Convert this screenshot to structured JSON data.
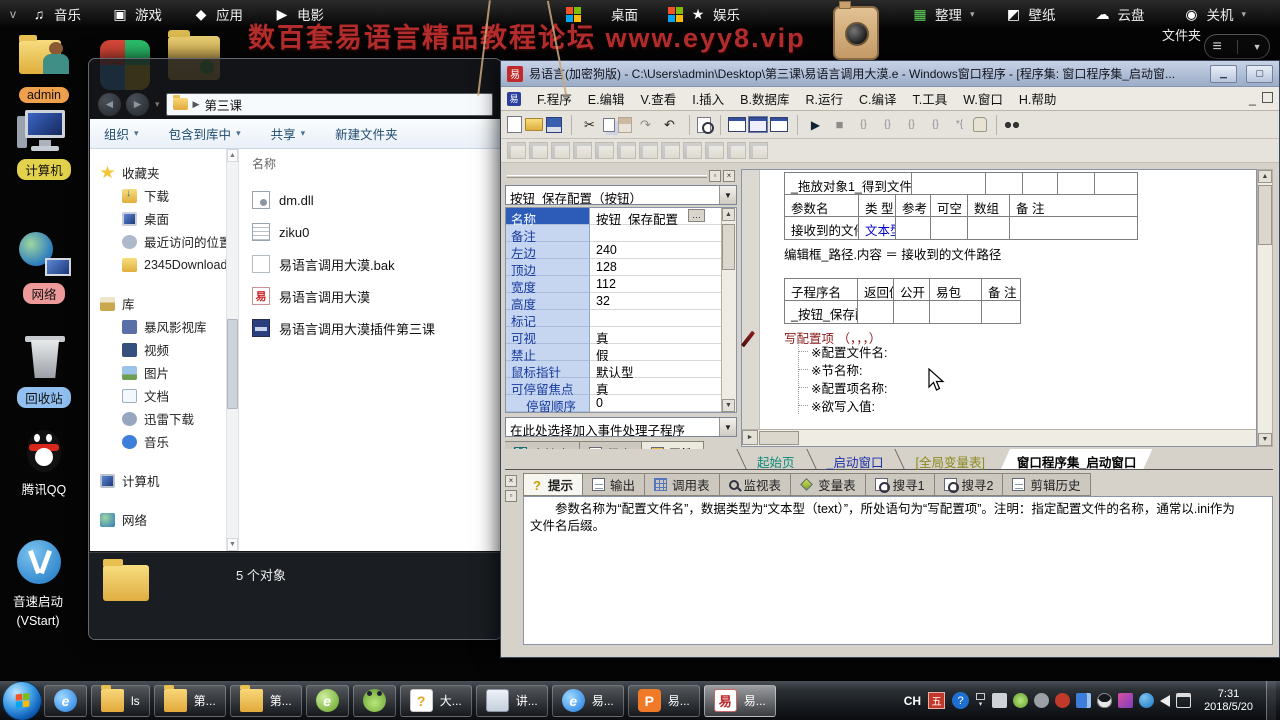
{
  "topbar": {
    "chevron": "v",
    "left": [
      {
        "label": "音乐",
        "icon": "music-icon",
        "g": "♫"
      },
      {
        "label": "游戏",
        "icon": "game-icon",
        "g": "▣"
      },
      {
        "label": "应用",
        "icon": "apps-icon",
        "g": "◆"
      },
      {
        "label": "电影",
        "icon": "movie-icon",
        "g": "▶"
      }
    ],
    "mid": [
      {
        "label": "桌面",
        "icon": "windows-desktop-icon",
        "g": ""
      },
      {
        "label": "娱乐",
        "icon": "entertainment-star-icon",
        "g": "★"
      }
    ],
    "right": [
      {
        "label": "整理",
        "icon": "organize-icon",
        "g": "▦",
        "dd": "▾",
        "green": "green"
      },
      {
        "label": "壁纸",
        "icon": "wallpaper-icon",
        "g": "◩",
        "dd": ""
      },
      {
        "label": "云盘",
        "icon": "cloud-icon",
        "g": "☁",
        "dd": ""
      },
      {
        "label": "关机",
        "icon": "power-icon",
        "g": "◉",
        "dd": "▾"
      }
    ]
  },
  "watermark": {
    "text": "数百套易语言精品教程论坛 www.eyy8.vip",
    "color": "#b22c2c"
  },
  "organizer": {
    "folder_label": "文件夹"
  },
  "desktop": {
    "icons": [
      {
        "label": "admin",
        "bubble": "#efa04d"
      },
      {
        "label": "计算机",
        "bubble": "#e3d24b"
      },
      {
        "label": "网络",
        "bubble": "#ef9a9a"
      },
      {
        "label": "回收站",
        "bubble": "#90bff0"
      },
      {
        "label": "腾讯QQ",
        "bubble": ""
      },
      {
        "label": "音速启动",
        "label2": "(VStart)",
        "bubble": ""
      }
    ]
  },
  "explorer": {
    "address": "第三课",
    "toolbar": [
      {
        "label": "组织",
        "dd": "▾"
      },
      {
        "label": "包含到库中",
        "dd": "▾"
      },
      {
        "label": "共享",
        "dd": "▾"
      },
      {
        "label": "新建文件夹",
        "dd": ""
      }
    ],
    "sidebar": [
      {
        "label": "收藏夹",
        "icon": "favorites-star-icon",
        "cls": "lv0",
        "ic": "s-star"
      },
      {
        "label": "下载",
        "icon": "downloads-icon",
        "cls": "lv1",
        "ic": "s-down"
      },
      {
        "label": "桌面",
        "icon": "desktop-location-icon",
        "cls": "lv1",
        "ic": "s-mon"
      },
      {
        "label": "最近访问的位置",
        "icon": "recent-places-icon",
        "cls": "lv1",
        "ic": "s-recent"
      },
      {
        "label": "2345Downloads",
        "icon": "folder-icon",
        "cls": "lv1",
        "ic": "s-folder"
      },
      {
        "label": "库",
        "icon": "libraries-icon",
        "cls": "lv0 gap",
        "ic": "s-lib"
      },
      {
        "label": "暴风影视库",
        "icon": "movie-library-icon",
        "cls": "lv1",
        "ic": "s-movie"
      },
      {
        "label": "视频",
        "icon": "videos-icon",
        "cls": "lv1",
        "ic": "s-video"
      },
      {
        "label": "图片",
        "icon": "pictures-icon",
        "cls": "lv1",
        "ic": "s-pic"
      },
      {
        "label": "文档",
        "icon": "documents-icon",
        "cls": "lv1",
        "ic": "s-doc"
      },
      {
        "label": "迅雷下载",
        "icon": "thunder-download-icon",
        "cls": "lv1",
        "ic": "s-thunder"
      },
      {
        "label": "音乐",
        "icon": "music-library-icon",
        "cls": "lv1",
        "ic": "s-music"
      },
      {
        "label": "计算机",
        "icon": "computer-icon",
        "cls": "lv0 gap",
        "ic": "s-computer"
      },
      {
        "label": "网络",
        "icon": "network-icon",
        "cls": "lv0 gap",
        "ic": "s-network"
      }
    ],
    "files_header": "名称",
    "files": [
      {
        "name": "dm.dll",
        "icon": "dll-file-icon",
        "ic": "f-dll",
        "g": ""
      },
      {
        "name": "ziku0",
        "icon": "text-file-icon",
        "ic": "f-txt",
        "g": ""
      },
      {
        "name": "易语言调用大漠.bak",
        "icon": "bak-file-icon",
        "ic": "f-bak",
        "g": ""
      },
      {
        "name": "易语言调用大漠",
        "icon": "elang-source-file-icon",
        "ic": "f-eyy",
        "g": "易"
      },
      {
        "name": "易语言调用大漠插件第三课",
        "icon": "media-file-icon",
        "ic": "f-media",
        "g": ""
      }
    ],
    "status": "5 个对象"
  },
  "ide": {
    "title": "易语言(加密狗版) - C:\\Users\\admin\\Desktop\\第三课\\易语言调用大漠.e - Windows窗口程序 - [程序集: 窗口程序集_启动窗...",
    "logo": "易",
    "menus": [
      {
        "label": "F.程序"
      },
      {
        "label": "E.编辑"
      },
      {
        "label": "V.查看"
      },
      {
        "label": "I.插入"
      },
      {
        "label": "B.数据库"
      },
      {
        "label": "R.运行"
      },
      {
        "label": "C.编译"
      },
      {
        "label": "T.工具"
      },
      {
        "label": "W.窗口"
      },
      {
        "label": "H.帮助"
      }
    ],
    "child_min": "_",
    "toolbar1": [
      {
        "name": "new-icon",
        "cls": "ti-doc",
        "g": ""
      },
      {
        "name": "open-icon",
        "cls": "ti-open",
        "g": ""
      },
      {
        "name": "save-icon",
        "cls": "ti-save",
        "g": ""
      },
      {
        "name": "separator",
        "cls": "ti-sep",
        "g": ""
      },
      {
        "name": "cut-icon",
        "cls": "",
        "g": "✂"
      },
      {
        "name": "copy-icon",
        "cls": "ti-copy",
        "g": ""
      },
      {
        "name": "paste-icon",
        "cls": "ti-paste dim",
        "g": ""
      },
      {
        "name": "redo-icon",
        "cls": "dim",
        "g": "↷"
      },
      {
        "name": "undo-icon",
        "cls": "",
        "g": "↶"
      },
      {
        "name": "separator",
        "cls": "ti-sep",
        "g": ""
      },
      {
        "name": "find-icon",
        "cls": "ti-find",
        "g": ""
      },
      {
        "name": "separator",
        "cls": "ti-sep",
        "g": ""
      },
      {
        "name": "window-layout-left-icon",
        "cls": "ti-win",
        "g": ""
      },
      {
        "name": "window-layout-bottom-icon",
        "cls": "ti-win on",
        "g": ""
      },
      {
        "name": "window-layout-grid-icon",
        "cls": "ti-win",
        "g": ""
      },
      {
        "name": "separator",
        "cls": "ti-sep",
        "g": ""
      },
      {
        "name": "run-icon",
        "cls": "run",
        "g": "▶"
      },
      {
        "name": "stop-icon",
        "cls": "dim",
        "g": "■"
      },
      {
        "name": "debug-breakpoint-icon",
        "cls": "dim2",
        "g": "{}"
      },
      {
        "name": "step-over-icon",
        "cls": "dim2",
        "g": "{}"
      },
      {
        "name": "step-into-icon",
        "cls": "dim2",
        "g": "{}"
      },
      {
        "name": "step-out-icon",
        "cls": "dim2",
        "g": "{}"
      },
      {
        "name": "run-to-cursor-icon",
        "cls": "dim2",
        "g": "*{"
      },
      {
        "name": "hand-icon",
        "cls": "ti-hand",
        "g": ""
      },
      {
        "name": "separator",
        "cls": "ti-sep",
        "g": ""
      },
      {
        "name": "find-in-files-icon",
        "cls": "ti-bino",
        "g": ""
      }
    ],
    "toolbar2": [
      {
        "name": "snap-grid-icon"
      },
      {
        "name": "align-left-icon"
      },
      {
        "name": "align-right-icon"
      },
      {
        "name": "align-top-icon"
      },
      {
        "name": "align-bottom-icon"
      },
      {
        "name": "center-horizontal-icon"
      },
      {
        "name": "center-vertical-icon"
      },
      {
        "name": "space-horizontal-icon"
      },
      {
        "name": "space-vertical-icon"
      },
      {
        "name": "same-width-icon"
      },
      {
        "name": "same-height-icon"
      },
      {
        "name": "same-size-icon"
      }
    ],
    "properties": {
      "selector": "按钮_保存配置（按钮）",
      "rows": [
        {
          "label": "名称",
          "value": "按钮_保存配置",
          "cls": "sel",
          "more": "…"
        },
        {
          "label": "备注",
          "value": "",
          "cls": "",
          "more": ""
        },
        {
          "label": "左边",
          "value": "240",
          "cls": "",
          "more": ""
        },
        {
          "label": "顶边",
          "value": "128",
          "cls": "",
          "more": ""
        },
        {
          "label": "宽度",
          "value": "112",
          "cls": "",
          "more": ""
        },
        {
          "label": "高度",
          "value": "32",
          "cls": "",
          "more": ""
        },
        {
          "label": "标记",
          "value": "",
          "cls": "",
          "more": ""
        },
        {
          "label": "可视",
          "value": "真",
          "cls": "",
          "more": ""
        },
        {
          "label": "禁止",
          "value": "假",
          "cls": "",
          "more": ""
        },
        {
          "label": "鼠标指针",
          "value": "默认型",
          "cls": "",
          "more": ""
        },
        {
          "label": "可停留焦点",
          "value": "真",
          "cls": "",
          "more": ""
        },
        {
          "label": "停留顺序",
          "value": "0",
          "cls": "ind",
          "more": ""
        }
      ],
      "event_selector": "在此处选择加入事件处理子程序",
      "tabs": [
        {
          "label": "支持库",
          "icon": "support-library-tab-icon",
          "cls": "",
          "ic": "mi-lib"
        },
        {
          "label": "程序",
          "icon": "program-tab-icon",
          "cls": "",
          "ic": "mi-prog"
        },
        {
          "label": "属性",
          "icon": "property-tab-icon",
          "cls": "on",
          "ic": "mi-prop"
        }
      ]
    },
    "code": {
      "t1_title": "_拖放对象1_得到文件",
      "t1_headers": [
        {
          "t": "参数名"
        },
        {
          "t": "类 型"
        },
        {
          "t": "参考"
        },
        {
          "t": "可空"
        },
        {
          "t": "数组"
        },
        {
          "t": "备 注"
        }
      ],
      "t1_row": [
        {
          "t": "接收到的文件路径",
          "cls": ""
        },
        {
          "t": "文本型",
          "cls": "blue"
        },
        {
          "t": ""
        },
        {
          "t": ""
        },
        {
          "t": ""
        },
        {
          "t": ""
        }
      ],
      "statement": "编辑框_路径.内容 ＝ 接收到的文件路径",
      "t2_headers": [
        {
          "t": "子程序名"
        },
        {
          "t": "返回值类型"
        },
        {
          "t": "公开"
        },
        {
          "t": "易包"
        },
        {
          "t": "备 注"
        }
      ],
      "t2_row": [
        {
          "t": "_按钮_保存配置_被单击"
        },
        {
          "t": ""
        },
        {
          "t": ""
        },
        {
          "t": ""
        },
        {
          "t": ""
        }
      ],
      "call": "写配置项 （，，，）",
      "params": [
        {
          "t": "※配置文件名:"
        },
        {
          "t": "※节名称:"
        },
        {
          "t": "※配置项名称:"
        },
        {
          "t": "※欲写入值:"
        }
      ]
    },
    "doc_tabs": [
      {
        "label": "起始页",
        "color": "#0d8a7a",
        "cls": ""
      },
      {
        "label": "_启动窗口",
        "color": "#1b2fa8",
        "cls": ""
      },
      {
        "label": "[全局变量表]",
        "color": "#8a8a1e",
        "cls": ""
      },
      {
        "label": "窗口程序集_启动窗口",
        "color": "#000000",
        "cls": "on"
      }
    ],
    "bottom_tabs": [
      {
        "label": "提示",
        "icon": "hint-tab-icon",
        "cls": "on",
        "ic": "mi-q",
        "g": "?"
      },
      {
        "label": "输出",
        "icon": "output-tab-icon",
        "cls": "",
        "ic": "mi-doc2",
        "g": ""
      },
      {
        "label": "调用表",
        "icon": "call-table-tab-icon",
        "cls": "",
        "ic": "mi-grid",
        "g": ""
      },
      {
        "label": "监视表",
        "icon": "watch-table-tab-icon",
        "cls": "",
        "ic": "mi-mag",
        "g": ""
      },
      {
        "label": "变量表",
        "icon": "variable-table-tab-icon",
        "cls": "",
        "ic": "mi-diamond",
        "g": ""
      },
      {
        "label": "搜寻1",
        "icon": "search1-tab-icon",
        "cls": "",
        "ic": "mi-magdoc",
        "g": ""
      },
      {
        "label": "搜寻2",
        "icon": "search2-tab-icon",
        "cls": "",
        "ic": "mi-magdoc",
        "g": ""
      },
      {
        "label": "剪辑历史",
        "icon": "clip-history-tab-icon",
        "cls": "",
        "ic": "mi-doc2",
        "g": ""
      }
    ],
    "hint_line1": "参数名称为“配置文件名”，数据类型为“文本型（text）”，所处语句为“写配置项”。注明：指定配置文件的名称，通常以.ini作为",
    "hint_line2": "文件名后缀。"
  },
  "taskbar": {
    "buttons": [
      {
        "icon": "ie-taskbar-icon",
        "ic": "tki-ie",
        "g": "e",
        "label": "",
        "state": ""
      },
      {
        "icon": "folder-taskbar-icon",
        "ic": "tki-folder",
        "g": "",
        "label": "ls",
        "state": ""
      },
      {
        "icon": "folder-taskbar-icon",
        "ic": "tki-folder",
        "g": "",
        "label": "第...",
        "state": ""
      },
      {
        "icon": "folder-taskbar-icon",
        "ic": "tki-folder",
        "g": "",
        "label": "第...",
        "state": ""
      },
      {
        "icon": "elang-green-taskbar-icon",
        "ic": "tki-egreen",
        "g": "e",
        "label": "",
        "state": ""
      },
      {
        "icon": "frog-taskbar-icon",
        "ic": "tki-frog",
        "g": "",
        "label": "",
        "state": ""
      },
      {
        "icon": "help-doc-taskbar-icon",
        "ic": "tki-help",
        "g": "?",
        "label": "大...",
        "state": ""
      },
      {
        "icon": "notepad-taskbar-icon",
        "ic": "tki-note",
        "g": "",
        "label": "讲...",
        "state": ""
      },
      {
        "icon": "ie-blue-taskbar-icon",
        "ic": "tki-eblue",
        "g": "e",
        "label": "易...",
        "state": ""
      },
      {
        "icon": "wps-taskbar-icon",
        "ic": "tki-wps",
        "g": "P",
        "label": "易...",
        "state": ""
      },
      {
        "icon": "elang-red-taskbar-icon",
        "ic": "tki-eyy",
        "g": "易",
        "label": "易...",
        "state": "active"
      }
    ],
    "tray": {
      "lang": "CH",
      "wubi": "五",
      "help": "?",
      "icons": [
        {
          "name": "input-method-tray-icon",
          "ic": "tr-kb"
        },
        {
          "name": "frog-tray-icon",
          "ic": "tr-frog"
        },
        {
          "name": "link-tray-icon",
          "ic": "tr-link"
        },
        {
          "name": "pinwheel-tray-icon",
          "ic": "tr-pin"
        },
        {
          "name": "panel-tray-icon",
          "ic": "tr-panel"
        },
        {
          "name": "qq-tray-icon",
          "ic": "tr-qq"
        },
        {
          "name": "media-tray-icon",
          "ic": "tr-media"
        },
        {
          "name": "vstart-tray-icon",
          "ic": "tr-v"
        },
        {
          "name": "volume-tray-icon",
          "ic": "tr-vol"
        },
        {
          "name": "network-tray-icon",
          "ic": "tr-net"
        }
      ],
      "time": "7:31",
      "date": "2018/5/20"
    }
  }
}
